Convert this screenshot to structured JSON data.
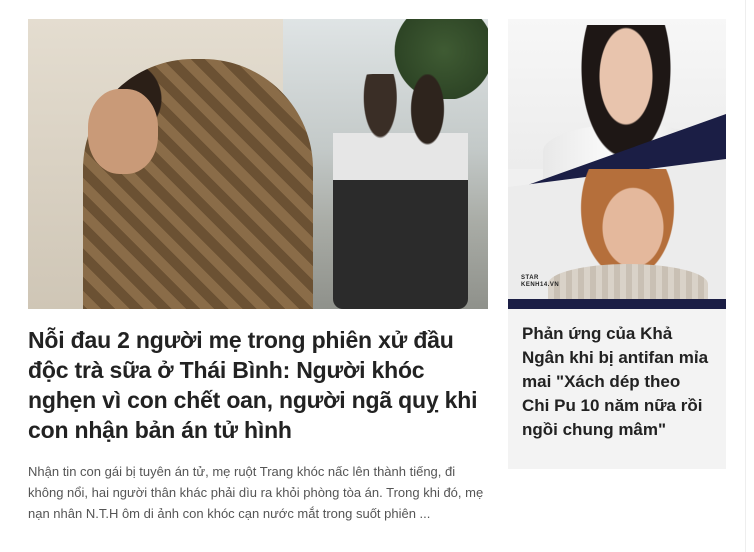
{
  "main_article": {
    "image_alt": "Hai người mẹ tại phiên xử",
    "title": "Nỗi đau 2 người mẹ trong phiên xử đầu độc trà sữa ở Thái Bình: Người khóc nghẹn vì con chết oan, người ngã quỵ khi con nhận bản án tử hình",
    "summary": "Nhận tin con gái bị tuyên án tử, mẹ ruột Trang khóc nấc lên thành tiếng, đi không nổi, hai người thân khác phải dìu ra khỏi phòng tòa án. Trong khi đó, mẹ nạn nhân N.T.H ôm di ảnh con khóc cạn nước mắt trong suốt phiên ..."
  },
  "side_article": {
    "image_alt": "Chi Pu và Khả Ngân",
    "brand_line1": "STAR",
    "brand_line2": "KENH14.VN",
    "title": "Phản ứng của Khả Ngân khi bị antifan mỉa mai \"Xách dép theo Chi Pu 10 năm nữa rồi ngồi chung mâm\""
  },
  "colors": {
    "title": "#222222",
    "summary": "#555555",
    "side_bg": "#f3f3f3",
    "navy": "#1b1e45"
  }
}
